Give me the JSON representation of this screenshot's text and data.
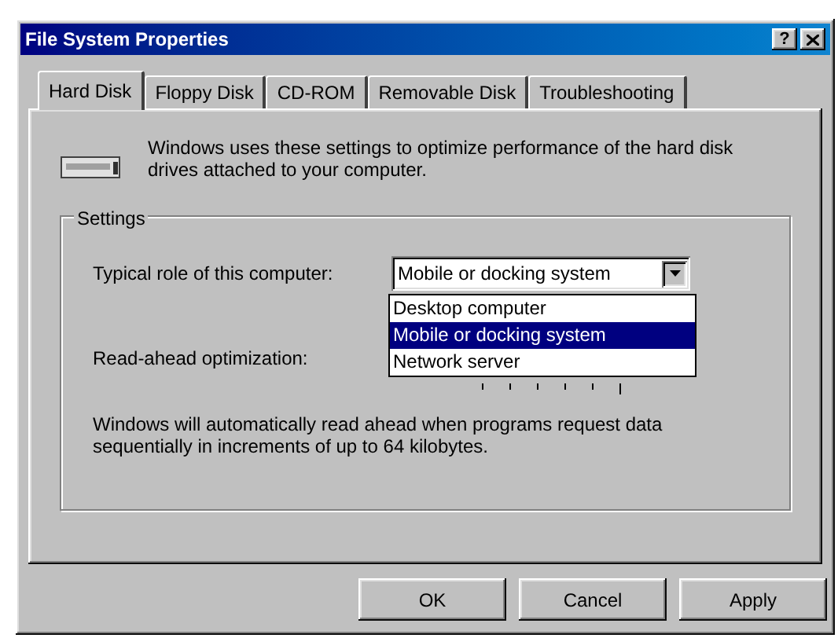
{
  "window": {
    "title": "File System Properties",
    "help_label": "?"
  },
  "tabs": [
    {
      "label": "Hard Disk",
      "selected": true
    },
    {
      "label": "Floppy Disk",
      "selected": false
    },
    {
      "label": "CD-ROM",
      "selected": false
    },
    {
      "label": "Removable Disk",
      "selected": false
    },
    {
      "label": "Troubleshooting",
      "selected": false
    }
  ],
  "intro": "Windows uses these settings to optimize performance of the hard disk drives attached to your computer.",
  "settings": {
    "label": "Settings",
    "role": {
      "label": "Typical role of this computer:",
      "value": "Mobile or docking system",
      "expanded": true,
      "options": [
        {
          "label": "Desktop computer",
          "selected": false
        },
        {
          "label": "Mobile or docking system",
          "selected": true
        },
        {
          "label": "Network server",
          "selected": false
        }
      ]
    },
    "read_ahead": {
      "label": "Read-ahead optimization:"
    },
    "description": "Windows will automatically read ahead when programs request data sequentially in increments of up to 64 kilobytes."
  },
  "buttons": [
    "OK",
    "Cancel",
    "Apply"
  ]
}
